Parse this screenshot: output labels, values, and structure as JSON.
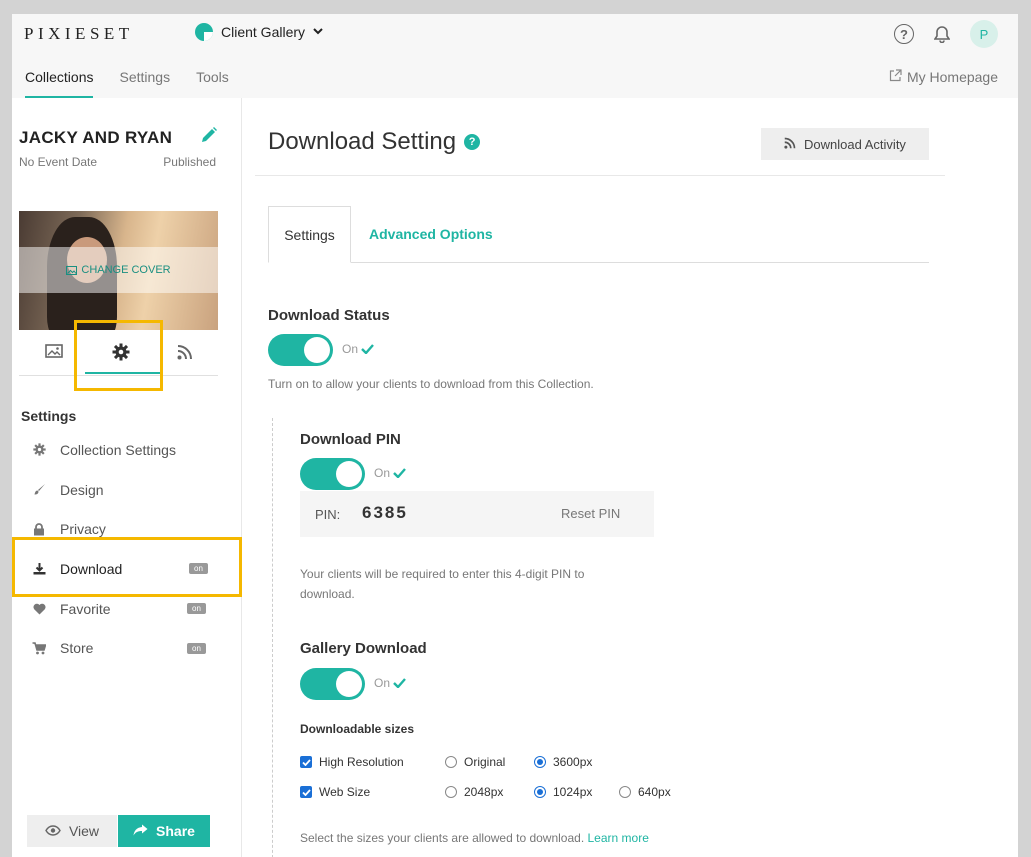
{
  "header": {
    "logo": "PIXIESET",
    "gallery_switch": "Client Gallery",
    "avatar_initial": "P"
  },
  "nav": {
    "tabs": [
      {
        "label": "Collections",
        "active": true
      },
      {
        "label": "Settings"
      },
      {
        "label": "Tools"
      }
    ],
    "homepage": "My Homepage"
  },
  "sidebar": {
    "collection_title": "JACKY AND RYAN",
    "event_date": "No Event Date",
    "status": "Published",
    "change_cover": "CHANGE COVER",
    "section_label": "Settings",
    "items": [
      {
        "label": "Collection Settings",
        "icon": "gear-icon"
      },
      {
        "label": "Design",
        "icon": "brush-icon"
      },
      {
        "label": "Privacy",
        "icon": "lock-icon"
      },
      {
        "label": "Download",
        "icon": "download-icon",
        "badge": "on",
        "active": true
      },
      {
        "label": "Favorite",
        "icon": "heart-icon",
        "badge": "on"
      },
      {
        "label": "Store",
        "icon": "cart-icon",
        "badge": "on"
      }
    ],
    "view_label": "View",
    "share_label": "Share"
  },
  "main": {
    "title": "Download Setting",
    "activity_button": "Download Activity",
    "tabs": {
      "settings": "Settings",
      "advanced": "Advanced Options"
    },
    "download_status": {
      "title": "Download Status",
      "state": "On",
      "help": "Turn on to allow your clients to download from this Collection."
    },
    "download_pin": {
      "title": "Download PIN",
      "state": "On",
      "pin_label": "PIN:",
      "pin_value": "6385",
      "reset_label": "Reset PIN",
      "help_line1": "Your clients will be required to enter this 4-digit PIN to",
      "help_line2": "download."
    },
    "gallery_download": {
      "title": "Gallery Download",
      "state": "On",
      "sizes_label": "Downloadable sizes",
      "high_res": {
        "label": "High Resolution",
        "checked": true,
        "options": [
          "Original",
          "3600px"
        ],
        "selected": "3600px"
      },
      "web_size": {
        "label": "Web Size",
        "checked": true,
        "options": [
          "2048px",
          "1024px",
          "640px"
        ],
        "selected": "1024px"
      },
      "help": "Select the sizes your clients are allowed to download.",
      "learn_more": "Learn more"
    }
  },
  "colors": {
    "accent": "#1fb5a3",
    "highlight": "#f5b800",
    "checkbox": "#1a6fd6"
  }
}
